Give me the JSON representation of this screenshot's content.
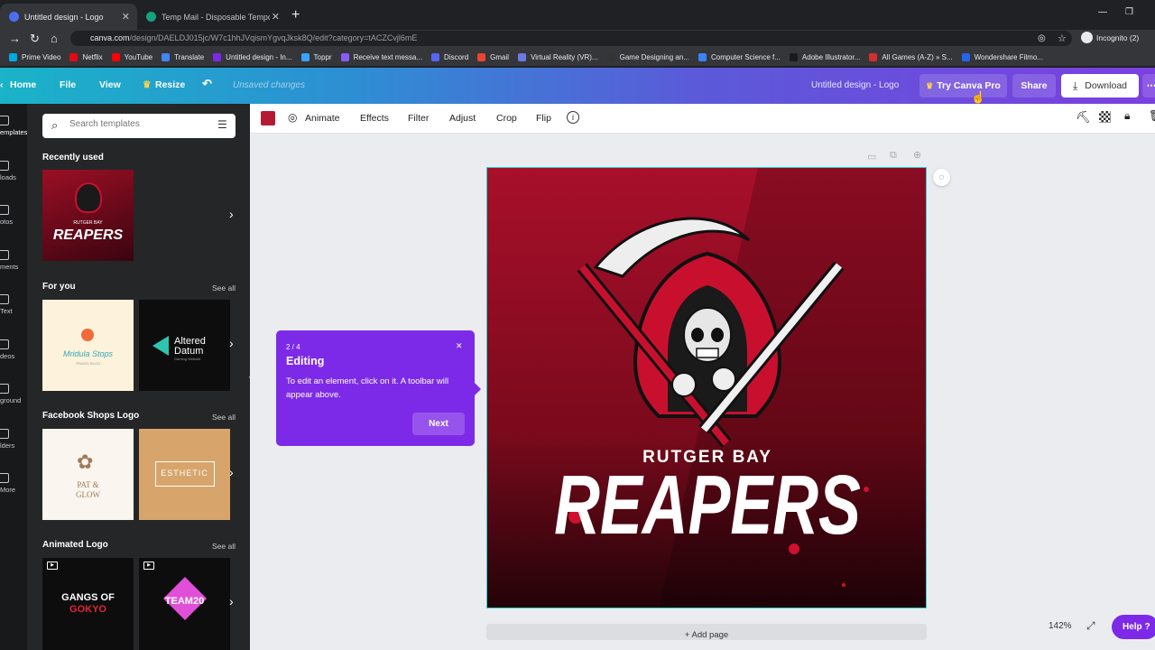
{
  "browser": {
    "tabs": [
      {
        "title": "Untitled design - Logo",
        "active": true
      },
      {
        "title": "Temp Mail - Disposable Tempora...",
        "active": false
      }
    ],
    "url_host": "canva.com",
    "url_rest": "/design/DAELDJ015jc/W7c1hhJVqismYgvqJksk8Q/edit?category=tACZCvjl6mE",
    "profile": "Incognito (2)",
    "bookmarks": [
      "Prime Video",
      "Netflix",
      "YouTube",
      "Translate",
      "Untitled design - In...",
      "Toppr",
      "Receive text messa...",
      "Discord",
      "Gmail",
      "Virtual Reality (VR)...",
      "Game Designing an...",
      "Computer Science f...",
      "Adobe Illustrator...",
      "All Games (A-Z) » S...",
      "Wondershare Filmo..."
    ]
  },
  "header": {
    "home": "Home",
    "file": "File",
    "view": "View",
    "resize": "Resize",
    "unsaved": "Unsaved changes",
    "doc_title": "Untitled design - Logo",
    "try_pro": "Try Canva Pro",
    "share": "Share",
    "download": "Download"
  },
  "rail": [
    {
      "label": "emplates",
      "active": true
    },
    {
      "label": "loads",
      "active": false
    },
    {
      "label": "otos",
      "active": false
    },
    {
      "label": "ments",
      "active": false
    },
    {
      "label": "Text",
      "active": false
    },
    {
      "label": "deos",
      "active": false
    },
    {
      "label": "ground",
      "active": false
    },
    {
      "label": "lders",
      "active": false
    },
    {
      "label": "More",
      "active": false
    }
  ],
  "panel": {
    "search_placeholder": "Search templates",
    "recently_used": "Recently used",
    "for_you": "For you",
    "facebook_shops": "Facebook Shops Logo",
    "animated": "Animated Logo",
    "see_all": "See all",
    "thumb_texts": {
      "recent_small": "RUTGER BAY",
      "recent_big": "REAPERS",
      "mridula": "Mridula Stops",
      "mridula_sub": "TRAVEL BLOG",
      "altered": "Altered",
      "datum": "Datum",
      "datum_sub": "Gaming Website",
      "pat": "PAT &",
      "glow": "GLOW",
      "esthetic": "ESTHETIC",
      "gangs": "GANGS OF",
      "gangs2": "GOKYO",
      "team": "TEAM20"
    }
  },
  "toolbar": {
    "animate": "Animate",
    "effects": "Effects",
    "filter": "Filter",
    "adjust": "Adjust",
    "crop": "Crop",
    "flip": "Flip",
    "swatch_color": "#b51a35"
  },
  "design": {
    "subtitle": "RUTGER BAY",
    "title": "REAPERS"
  },
  "tooltip": {
    "step": "2 / 4",
    "title": "Editing",
    "body": "To edit an element, click on it. A toolbar will appear above.",
    "next": "Next"
  },
  "footer": {
    "add_page": "+ Add page",
    "zoom": "142%",
    "help": "Help ?"
  }
}
